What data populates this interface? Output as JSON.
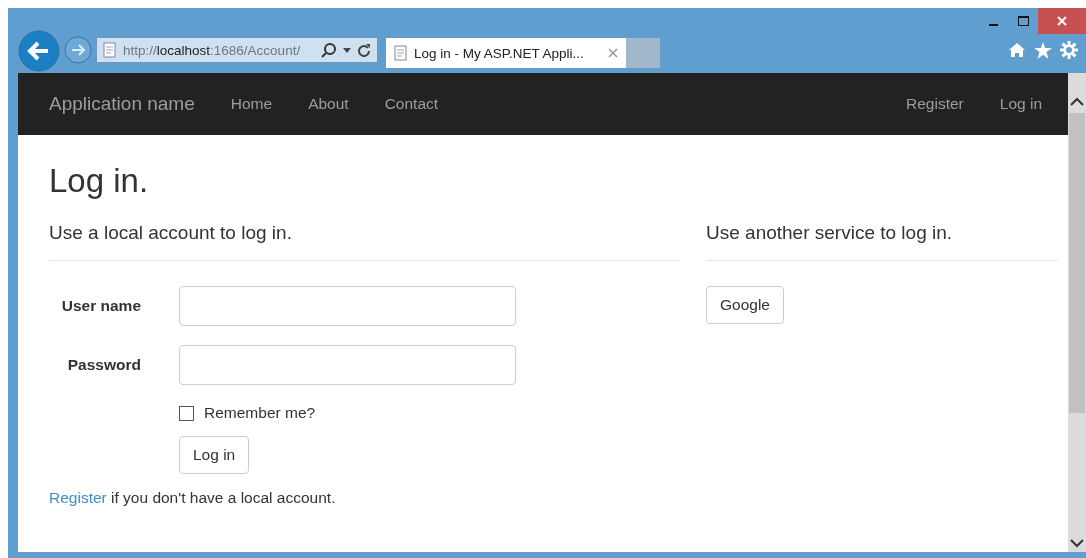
{
  "browser": {
    "address": {
      "prefix": "http://",
      "host": "localhost",
      "rest": ":1686/Account/"
    },
    "tab": {
      "title": "Log in - My ASP.NET Appli..."
    }
  },
  "navbar": {
    "brand": "Application name",
    "left": [
      "Home",
      "About",
      "Contact"
    ],
    "right": [
      "Register",
      "Log in"
    ]
  },
  "page": {
    "title": "Log in.",
    "local_heading": "Use a local account to log in.",
    "fields": [
      {
        "label": "User name"
      },
      {
        "label": "Password"
      }
    ],
    "remember": {
      "label": "Remember me?",
      "checked": false
    },
    "submit": "Log in",
    "register_link": "Register",
    "register_rest": " if you don't have a local account.",
    "external_heading": "Use another service to log in.",
    "providers": [
      "Google"
    ]
  }
}
